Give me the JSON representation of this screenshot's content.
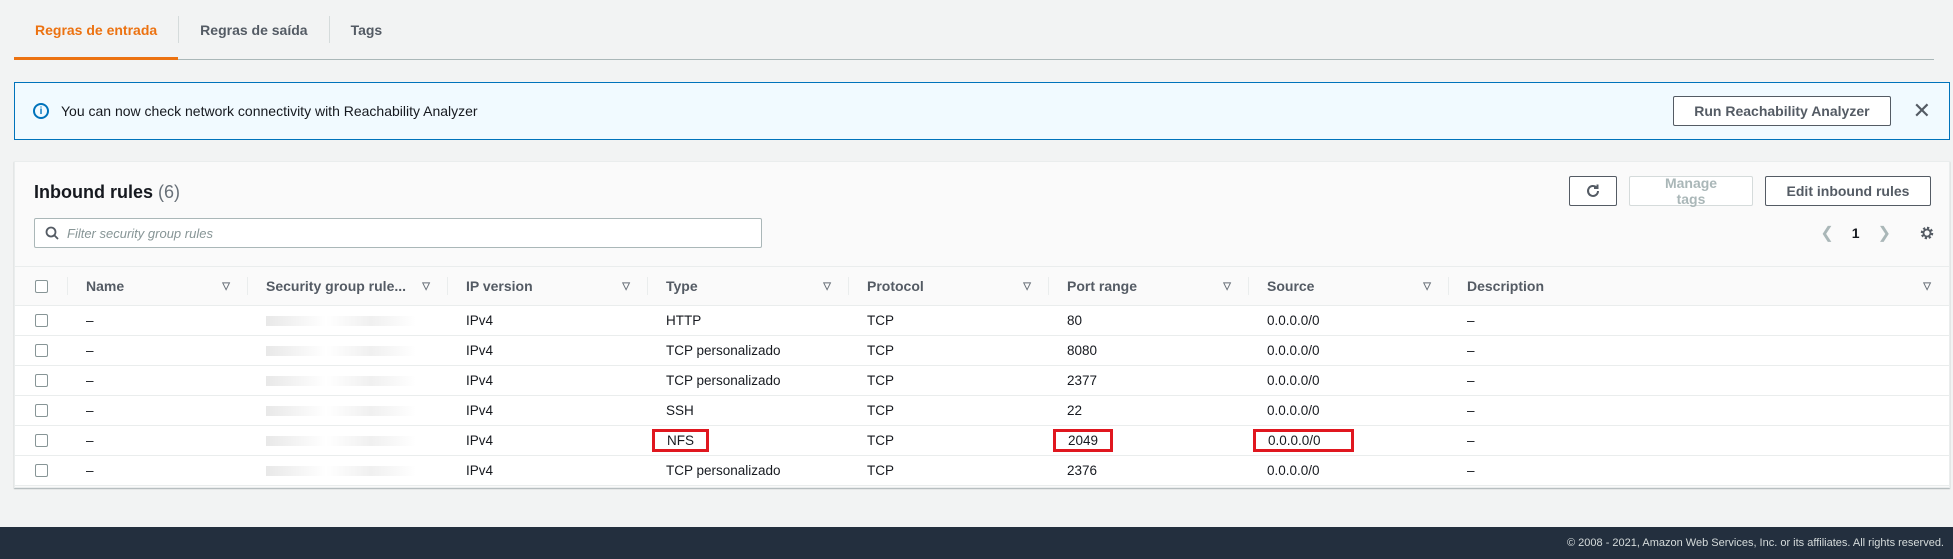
{
  "tabs": [
    {
      "label": "Regras de entrada",
      "active": true
    },
    {
      "label": "Regras de saída",
      "active": false
    },
    {
      "label": "Tags",
      "active": false
    }
  ],
  "banner": {
    "text": "You can now check network connectivity with Reachability Analyzer",
    "button_label": "Run Reachability Analyzer",
    "close_glyph": "✕"
  },
  "panel": {
    "title": "Inbound rules",
    "count": "(6)",
    "manage_tags_label": "Manage tags",
    "edit_label": "Edit inbound rules",
    "search_placeholder": "Filter security group rules",
    "page": "1"
  },
  "table": {
    "columns": [
      "Name",
      "Security group rule...",
      "IP version",
      "Type",
      "Protocol",
      "Port range",
      "Source",
      "Description"
    ],
    "rows": [
      {
        "name": "–",
        "ip": "IPv4",
        "type": "HTTP",
        "protocol": "TCP",
        "port": "80",
        "source": "0.0.0.0/0",
        "description": "–"
      },
      {
        "name": "–",
        "ip": "IPv4",
        "type": "TCP personalizado",
        "protocol": "TCP",
        "port": "8080",
        "source": "0.0.0.0/0",
        "description": "–"
      },
      {
        "name": "–",
        "ip": "IPv4",
        "type": "TCP personalizado",
        "protocol": "TCP",
        "port": "2377",
        "source": "0.0.0.0/0",
        "description": "–"
      },
      {
        "name": "–",
        "ip": "IPv4",
        "type": "SSH",
        "protocol": "TCP",
        "port": "22",
        "source": "0.0.0.0/0",
        "description": "–"
      },
      {
        "name": "–",
        "ip": "IPv4",
        "type": "NFS",
        "protocol": "TCP",
        "port": "2049",
        "source": "0.0.0.0/0",
        "description": "–"
      },
      {
        "name": "–",
        "ip": "IPv4",
        "type": "TCP personalizado",
        "protocol": "TCP",
        "port": "2376",
        "source": "0.0.0.0/0",
        "description": "–"
      }
    ]
  },
  "footer": {
    "text": "© 2008 - 2021, Amazon Web Services, Inc. or its affiliates. All rights reserved."
  },
  "colors": {
    "accent": "#ec7211",
    "info": "#0073bb",
    "highlight": "#e0171f",
    "footer_bg": "#232f3e"
  }
}
